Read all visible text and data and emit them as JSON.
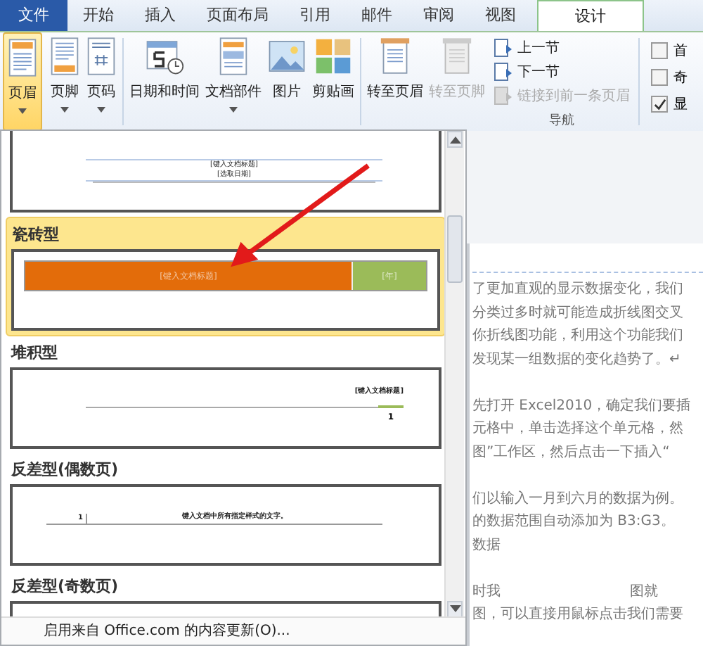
{
  "tabs": [
    {
      "label": "文件",
      "kind": "file",
      "selected": false
    },
    {
      "label": "开始",
      "kind": "normal",
      "selected": false
    },
    {
      "label": "插入",
      "kind": "normal",
      "selected": false
    },
    {
      "label": "页面布局",
      "kind": "normal",
      "selected": false
    },
    {
      "label": "引用",
      "kind": "normal",
      "selected": false
    },
    {
      "label": "邮件",
      "kind": "normal",
      "selected": false
    },
    {
      "label": "审阅",
      "kind": "normal",
      "selected": false
    },
    {
      "label": "视图",
      "kind": "normal",
      "selected": false
    },
    {
      "label": "设计",
      "kind": "context",
      "selected": true
    }
  ],
  "ribbon": {
    "large_buttons": [
      {
        "label": "页眉",
        "dropdown": true,
        "selected": true,
        "disabled": false
      },
      {
        "label": "页脚",
        "dropdown": true,
        "selected": false,
        "disabled": false
      },
      {
        "label": "页码",
        "dropdown": true,
        "selected": false,
        "disabled": false
      },
      {
        "label": "日期和时间",
        "dropdown": false,
        "selected": false,
        "disabled": false
      },
      {
        "label": "文档部件",
        "dropdown": true,
        "selected": false,
        "disabled": false
      },
      {
        "label": "图片",
        "dropdown": false,
        "selected": false,
        "disabled": false
      },
      {
        "label": "剪贴画",
        "dropdown": false,
        "selected": false,
        "disabled": false
      },
      {
        "label": "转至页眉",
        "dropdown": false,
        "selected": false,
        "disabled": false
      },
      {
        "label": "转至页脚",
        "dropdown": false,
        "selected": false,
        "disabled": true
      }
    ],
    "small_buttons": [
      {
        "label": "上一节",
        "disabled": false
      },
      {
        "label": "下一节",
        "disabled": false
      },
      {
        "label": "链接到前一条页眉",
        "disabled": true
      }
    ],
    "nav_group_label": "导航",
    "checkboxes": [
      {
        "label": "首",
        "checked": false
      },
      {
        "label": "奇",
        "checked": false
      },
      {
        "label": "显",
        "checked": true
      }
    ]
  },
  "gallery": {
    "items": [
      {
        "kind": "plain",
        "selected": false,
        "texts": [
          "[键入文档标题]",
          "[选取日期]"
        ]
      },
      {
        "label": "瓷砖型",
        "kind": "tile",
        "selected": true,
        "texts": [
          "[键入文档标题]",
          "[年]"
        ]
      },
      {
        "label": "堆积型",
        "kind": "stack",
        "selected": false,
        "texts": [
          "[键入文档标题]",
          "1"
        ]
      },
      {
        "label": "反差型(偶数页)",
        "kind": "contrast",
        "selected": false,
        "texts": [
          "1",
          "键入文档中所有指定样式的文字。"
        ]
      },
      {
        "label": "反差型(奇数页)",
        "kind": "cut",
        "selected": false
      }
    ],
    "footer": "启用来自 Office.com 的内容更新(O)..."
  },
  "document": {
    "lines": [
      {
        "text": "了更加直观的显示数据变化，我们"
      },
      {
        "text": "分类过多时就可能造成折线图交叉"
      },
      {
        "text": "你折线图功能，利用这个功能我们"
      },
      {
        "text": "发现某一组数据的变化趋势了。↵"
      },
      {
        "text": "先打开 Excel2010，确定我们要插",
        "gap_before": true
      },
      {
        "text": "元格中，单击选择这个单元格，然"
      },
      {
        "text": "图”工作区，然后点击一下插入“"
      },
      {
        "text": "们以输入一月到六月的数据为例。",
        "gap_before": true
      },
      {
        "text": "的数据范围自动添加为 B3:G3。"
      },
      {
        "text": "数据"
      },
      {
        "text": "时我",
        "right": "图就",
        "gap_before": true
      },
      {
        "text": "图，可以直接用鼠标点击我们需要"
      }
    ]
  }
}
